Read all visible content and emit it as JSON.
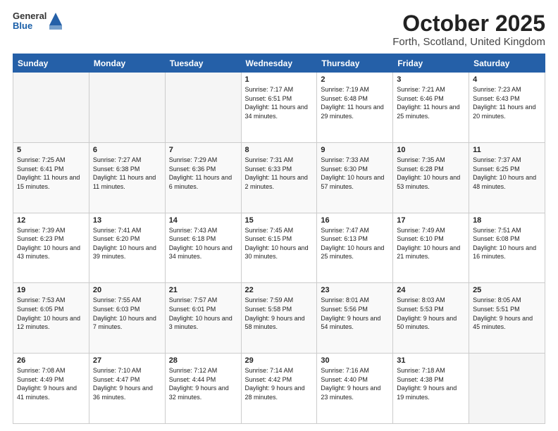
{
  "header": {
    "logo_general": "General",
    "logo_blue": "Blue",
    "title": "October 2025",
    "subtitle": "Forth, Scotland, United Kingdom"
  },
  "days_of_week": [
    "Sunday",
    "Monday",
    "Tuesday",
    "Wednesday",
    "Thursday",
    "Friday",
    "Saturday"
  ],
  "weeks": [
    [
      {
        "day": "",
        "empty": true
      },
      {
        "day": "",
        "empty": true
      },
      {
        "day": "",
        "empty": true
      },
      {
        "day": "1",
        "sunrise": "7:17 AM",
        "sunset": "6:51 PM",
        "daylight": "11 hours and 34 minutes."
      },
      {
        "day": "2",
        "sunrise": "7:19 AM",
        "sunset": "6:48 PM",
        "daylight": "11 hours and 29 minutes."
      },
      {
        "day": "3",
        "sunrise": "7:21 AM",
        "sunset": "6:46 PM",
        "daylight": "11 hours and 25 minutes."
      },
      {
        "day": "4",
        "sunrise": "7:23 AM",
        "sunset": "6:43 PM",
        "daylight": "11 hours and 20 minutes."
      }
    ],
    [
      {
        "day": "5",
        "sunrise": "7:25 AM",
        "sunset": "6:41 PM",
        "daylight": "11 hours and 15 minutes."
      },
      {
        "day": "6",
        "sunrise": "7:27 AM",
        "sunset": "6:38 PM",
        "daylight": "11 hours and 11 minutes."
      },
      {
        "day": "7",
        "sunrise": "7:29 AM",
        "sunset": "6:36 PM",
        "daylight": "11 hours and 6 minutes."
      },
      {
        "day": "8",
        "sunrise": "7:31 AM",
        "sunset": "6:33 PM",
        "daylight": "11 hours and 2 minutes."
      },
      {
        "day": "9",
        "sunrise": "7:33 AM",
        "sunset": "6:30 PM",
        "daylight": "10 hours and 57 minutes."
      },
      {
        "day": "10",
        "sunrise": "7:35 AM",
        "sunset": "6:28 PM",
        "daylight": "10 hours and 53 minutes."
      },
      {
        "day": "11",
        "sunrise": "7:37 AM",
        "sunset": "6:25 PM",
        "daylight": "10 hours and 48 minutes."
      }
    ],
    [
      {
        "day": "12",
        "sunrise": "7:39 AM",
        "sunset": "6:23 PM",
        "daylight": "10 hours and 43 minutes."
      },
      {
        "day": "13",
        "sunrise": "7:41 AM",
        "sunset": "6:20 PM",
        "daylight": "10 hours and 39 minutes."
      },
      {
        "day": "14",
        "sunrise": "7:43 AM",
        "sunset": "6:18 PM",
        "daylight": "10 hours and 34 minutes."
      },
      {
        "day": "15",
        "sunrise": "7:45 AM",
        "sunset": "6:15 PM",
        "daylight": "10 hours and 30 minutes."
      },
      {
        "day": "16",
        "sunrise": "7:47 AM",
        "sunset": "6:13 PM",
        "daylight": "10 hours and 25 minutes."
      },
      {
        "day": "17",
        "sunrise": "7:49 AM",
        "sunset": "6:10 PM",
        "daylight": "10 hours and 21 minutes."
      },
      {
        "day": "18",
        "sunrise": "7:51 AM",
        "sunset": "6:08 PM",
        "daylight": "10 hours and 16 minutes."
      }
    ],
    [
      {
        "day": "19",
        "sunrise": "7:53 AM",
        "sunset": "6:05 PM",
        "daylight": "10 hours and 12 minutes."
      },
      {
        "day": "20",
        "sunrise": "7:55 AM",
        "sunset": "6:03 PM",
        "daylight": "10 hours and 7 minutes."
      },
      {
        "day": "21",
        "sunrise": "7:57 AM",
        "sunset": "6:01 PM",
        "daylight": "10 hours and 3 minutes."
      },
      {
        "day": "22",
        "sunrise": "7:59 AM",
        "sunset": "5:58 PM",
        "daylight": "9 hours and 58 minutes."
      },
      {
        "day": "23",
        "sunrise": "8:01 AM",
        "sunset": "5:56 PM",
        "daylight": "9 hours and 54 minutes."
      },
      {
        "day": "24",
        "sunrise": "8:03 AM",
        "sunset": "5:53 PM",
        "daylight": "9 hours and 50 minutes."
      },
      {
        "day": "25",
        "sunrise": "8:05 AM",
        "sunset": "5:51 PM",
        "daylight": "9 hours and 45 minutes."
      }
    ],
    [
      {
        "day": "26",
        "sunrise": "7:08 AM",
        "sunset": "4:49 PM",
        "daylight": "9 hours and 41 minutes."
      },
      {
        "day": "27",
        "sunrise": "7:10 AM",
        "sunset": "4:47 PM",
        "daylight": "9 hours and 36 minutes."
      },
      {
        "day": "28",
        "sunrise": "7:12 AM",
        "sunset": "4:44 PM",
        "daylight": "9 hours and 32 minutes."
      },
      {
        "day": "29",
        "sunrise": "7:14 AM",
        "sunset": "4:42 PM",
        "daylight": "9 hours and 28 minutes."
      },
      {
        "day": "30",
        "sunrise": "7:16 AM",
        "sunset": "4:40 PM",
        "daylight": "9 hours and 23 minutes."
      },
      {
        "day": "31",
        "sunrise": "7:18 AM",
        "sunset": "4:38 PM",
        "daylight": "9 hours and 19 minutes."
      },
      {
        "day": "",
        "empty": true
      }
    ]
  ],
  "labels": {
    "sunrise": "Sunrise:",
    "sunset": "Sunset:",
    "daylight": "Daylight:"
  }
}
